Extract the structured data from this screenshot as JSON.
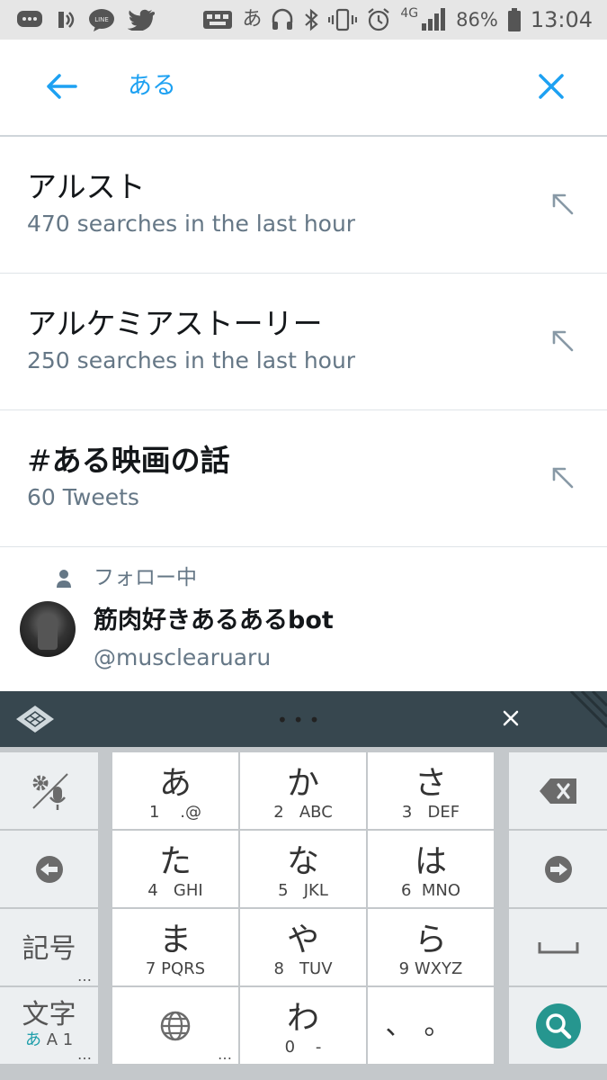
{
  "status_bar": {
    "battery": "86%",
    "time": "13:04",
    "network": "4G",
    "ime_indicator": "あ",
    "left_icons": [
      "chat-bubble-icon",
      "nfc-icon",
      "line-icon",
      "twitter-icon"
    ],
    "right_icons": [
      "keyboard-icon",
      "headphones-icon",
      "bluetooth-icon",
      "vibrate-icon",
      "alarm-icon",
      "signal-icon",
      "battery-icon"
    ]
  },
  "search": {
    "query": "ある",
    "back_icon": "arrow-left-icon",
    "clear_icon": "close-icon",
    "accent_color": "#1da1f2"
  },
  "suggestions": [
    {
      "title": "アルスト",
      "subtitle": "470 searches in the last hour"
    },
    {
      "title": "アルケミアストーリー",
      "subtitle": "250 searches in the last hour"
    },
    {
      "title_hash": "#",
      "title_rest": "ある映画の話",
      "subtitle": "60 Tweets"
    }
  ],
  "user_suggestion": {
    "follow_label": "フォロー中",
    "name": "筋肉好きあるあるbot",
    "handle": "@musclearuaru"
  },
  "keyboard": {
    "toolbar_dots": "•••",
    "keys": {
      "a": {
        "kana": "あ",
        "sub": "1    .@"
      },
      "ka": {
        "kana": "か",
        "sub": "2   ABC"
      },
      "sa": {
        "kana": "さ",
        "sub": "3   DEF"
      },
      "ta": {
        "kana": "た",
        "sub": "4   GHI"
      },
      "na": {
        "kana": "な",
        "sub": "5   JKL"
      },
      "ha": {
        "kana": "は",
        "sub": "6  MNO"
      },
      "ma": {
        "kana": "ま",
        "sub": "7 PQRS"
      },
      "ya": {
        "kana": "や",
        "sub": "8   TUV"
      },
      "ra": {
        "kana": "ら",
        "sub": "9 WXYZ"
      },
      "wa": {
        "kana": "わ",
        "sub": "0    -"
      },
      "punct": {
        "kana": "、。"
      },
      "symbol": {
        "label": "記号",
        "ellipsis": "…"
      },
      "mode": {
        "label": "文字",
        "sub_highlight": "あ",
        "sub_rest": "A 1",
        "ellipsis": "…"
      },
      "globe": {
        "ellipsis": "…"
      }
    },
    "search_key_color": "#26968f"
  }
}
